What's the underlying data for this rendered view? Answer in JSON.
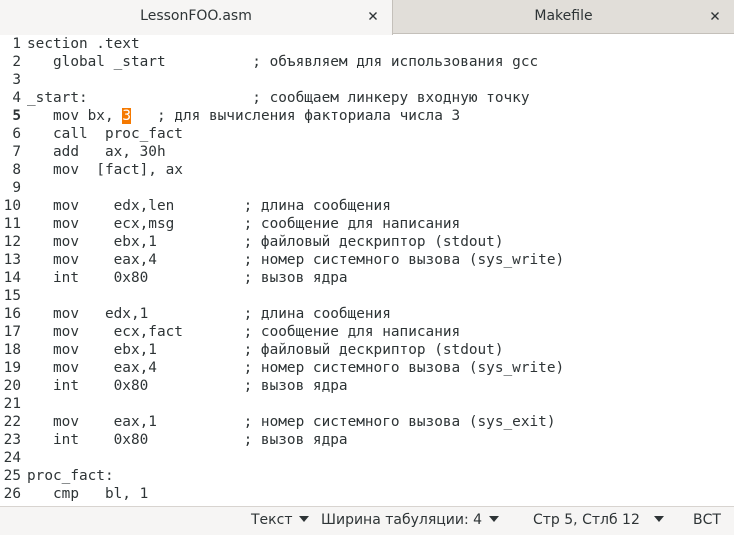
{
  "tabs": [
    {
      "label": "LessonFOO.asm",
      "active": true
    },
    {
      "label": "Makefile",
      "active": false
    }
  ],
  "editor": {
    "current_line": 5,
    "lines": [
      {
        "n": "1",
        "text": "section .text"
      },
      {
        "n": "2",
        "text": "   global _start          ; объявляем для использования gcc"
      },
      {
        "n": "3",
        "text": ""
      },
      {
        "n": "4",
        "text": "_start:                   ; сообщаем линкеру входную точку"
      },
      {
        "n": "5",
        "pre": "   mov bx, ",
        "hl": "3",
        "post": "   ; для вычисления факториала числа 3"
      },
      {
        "n": "6",
        "text": "   call  proc_fact"
      },
      {
        "n": "7",
        "text": "   add   ax, 30h"
      },
      {
        "n": "8",
        "text": "   mov  [fact], ax"
      },
      {
        "n": "9",
        "text": ""
      },
      {
        "n": "10",
        "text": "   mov    edx,len        ; длина сообщения"
      },
      {
        "n": "11",
        "text": "   mov    ecx,msg        ; сообщение для написания"
      },
      {
        "n": "12",
        "text": "   mov    ebx,1          ; файловый дескриптор (stdout)"
      },
      {
        "n": "13",
        "text": "   mov    eax,4          ; номер системного вызова (sys_write)"
      },
      {
        "n": "14",
        "text": "   int    0x80           ; вызов ядра"
      },
      {
        "n": "15",
        "text": ""
      },
      {
        "n": "16",
        "text": "   mov   edx,1           ; длина сообщения"
      },
      {
        "n": "17",
        "text": "   mov    ecx,fact       ; сообщение для написания"
      },
      {
        "n": "18",
        "text": "   mov    ebx,1          ; файловый дескриптор (stdout)"
      },
      {
        "n": "19",
        "text": "   mov    eax,4          ; номер системного вызова (sys_write)"
      },
      {
        "n": "20",
        "text": "   int    0x80           ; вызов ядра"
      },
      {
        "n": "21",
        "text": ""
      },
      {
        "n": "22",
        "text": "   mov    eax,1          ; номер системного вызова (sys_exit)"
      },
      {
        "n": "23",
        "text": "   int    0x80           ; вызов ядра"
      },
      {
        "n": "24",
        "text": ""
      },
      {
        "n": "25",
        "text": "proc_fact:"
      },
      {
        "n": "26",
        "text": "   cmp   bl, 1"
      }
    ]
  },
  "statusbar": {
    "language": "Текст",
    "tab_width": "Ширина табуляции: 4",
    "position": "Стр 5, Стлб 12",
    "mode": "ВСТ"
  },
  "colors": {
    "selection": "#f57900",
    "tabbar": "#e1ded9",
    "active_tab": "#f6f5f4"
  }
}
